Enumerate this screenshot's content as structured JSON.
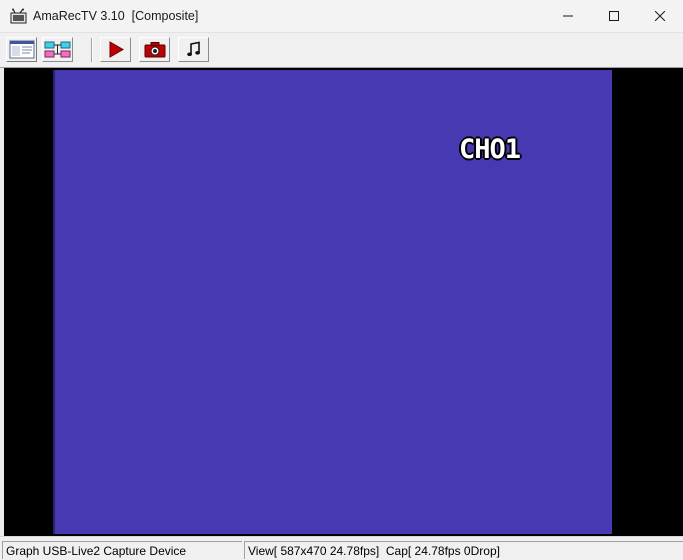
{
  "window": {
    "title": "AmaRecTV 3.10  [Composite]",
    "controls": {
      "minimize": "minimize-icon",
      "maximize": "maximize-icon",
      "close": "close-icon"
    }
  },
  "toolbar": {
    "buttons": [
      {
        "name": "view-mode-button",
        "icon": "window-layout-icon"
      },
      {
        "name": "graph-button",
        "icon": "graph-filter-icon"
      },
      {
        "name": "record-button",
        "icon": "play-record-icon",
        "color": "#c00000"
      },
      {
        "name": "capture-button",
        "icon": "camera-icon",
        "color": "#c00000"
      },
      {
        "name": "audio-button",
        "icon": "music-note-icon"
      }
    ]
  },
  "video": {
    "osd_text": "CHO1",
    "background_color": "#4739b2"
  },
  "statusbar": {
    "device": "Graph USB-Live2 Capture Device",
    "stats": "View[ 587x470 24.78fps]  Cap[ 24.78fps 0Drop]"
  }
}
